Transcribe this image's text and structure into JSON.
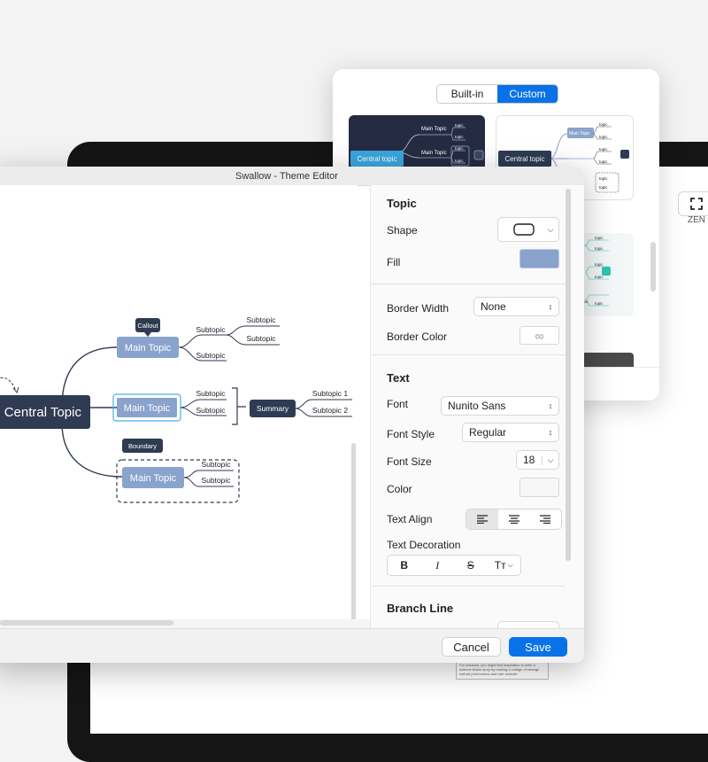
{
  "background_app": {
    "zen_label": "ZEN",
    "note_text": "For instance, you might find inspiration to write a science fiction story by making a collage of strange natural phenomena and rare animals."
  },
  "gallery": {
    "tabs": [
      "Built-in",
      "Custom"
    ],
    "active_tab": "Custom",
    "thumb_dark": {
      "central": "Central topic",
      "main1": "Main Topic",
      "main2": "Main Topic",
      "sub": "topic"
    },
    "thumb_light": {
      "central": "Central topic",
      "main": "Main Topic",
      "sub": "topic"
    },
    "thumb_teal": {
      "sub": "topic",
      "part": "pic"
    }
  },
  "editor": {
    "title": "Swallow - Theme Editor",
    "map": {
      "central": "Central Topic",
      "main1": "Main Topic",
      "main2": "Main Topic",
      "main3": "Main Topic",
      "callout": "Callout",
      "boundary": "Boundary",
      "summary": "Summary",
      "subtopic": "Subtopic",
      "subtopic1": "Subtopic 1",
      "subtopic2": "Subtopic 2"
    },
    "panel": {
      "topic_title": "Topic",
      "shape_label": "Shape",
      "fill_label": "Fill",
      "fill_color": "#8aa3cc",
      "border_width_label": "Border Width",
      "border_width_value": "None",
      "border_color_label": "Border Color",
      "text_title": "Text",
      "font_label": "Font",
      "font_value": "Nunito Sans",
      "font_style_label": "Font Style",
      "font_style_value": "Regular",
      "font_size_label": "Font Size",
      "font_size_value": "18",
      "color_label": "Color",
      "text_align_label": "Text Align",
      "text_decoration_label": "Text Decoration",
      "deco_bold": "B",
      "deco_italic": "I",
      "deco_strike": "S",
      "deco_case": "Tт",
      "branch_line_title": "Branch Line"
    },
    "footer": {
      "cancel": "Cancel",
      "save": "Save"
    }
  },
  "colors": {
    "accent": "#0a72e8",
    "central_topic": "#2e3b52",
    "main_topic": "#8aa3cc",
    "teal": "#2fc4b2"
  }
}
